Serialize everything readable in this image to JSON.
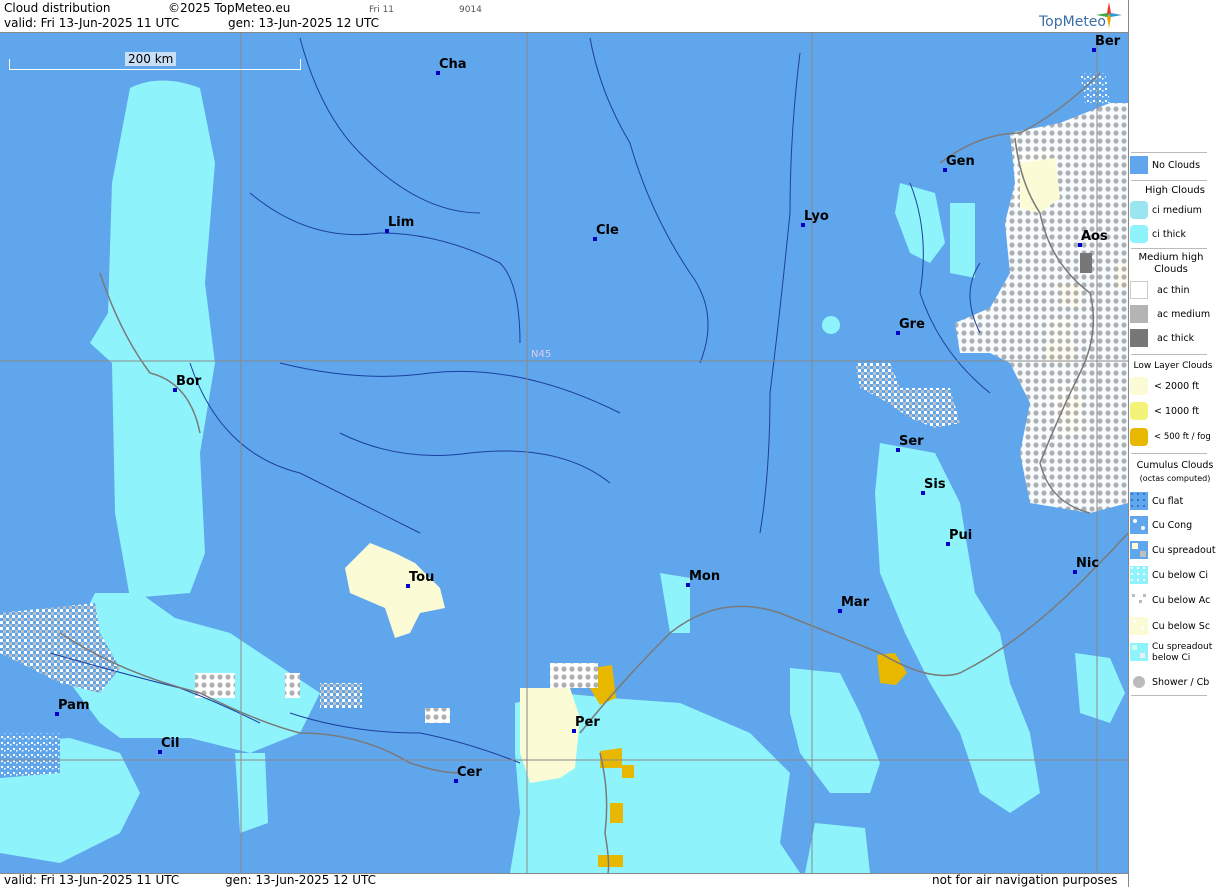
{
  "header": {
    "title": "Cloud distribution",
    "copyright": "©2025 TopMeteo.eu",
    "valid": "valid:  Fri  13-Jun-2025  11 UTC",
    "gen": "gen: 13-Jun-2025 12 UTC",
    "small1": "Fri 11",
    "small2": "9014",
    "logo": "TopMeteo"
  },
  "footer": {
    "valid": "valid:  Fri  13-Jun-2025  11 UTC",
    "gen": "gen: 13-Jun-2025 12 UTC",
    "notice": "not for air navigation purposes"
  },
  "map": {
    "scale": "200 km",
    "grid_label": "N45",
    "cities": [
      {
        "name": "Cha"
      },
      {
        "name": "Ber"
      },
      {
        "name": "Lim"
      },
      {
        "name": "Cle"
      },
      {
        "name": "Lyo"
      },
      {
        "name": "Gen"
      },
      {
        "name": "Aos"
      },
      {
        "name": "Gre"
      },
      {
        "name": "Bor"
      },
      {
        "name": "Ser"
      },
      {
        "name": "Sis"
      },
      {
        "name": "Pui"
      },
      {
        "name": "Tou"
      },
      {
        "name": "Mon"
      },
      {
        "name": "Mar"
      },
      {
        "name": "Nic"
      },
      {
        "name": "Pam"
      },
      {
        "name": "Cil"
      },
      {
        "name": "Per"
      },
      {
        "name": "Cer"
      }
    ]
  },
  "legend": {
    "no_clouds": "No Clouds",
    "high_clouds": "High Clouds",
    "ci_medium": "ci medium",
    "ci_thick": "ci thick",
    "medium_high": "Medium high Clouds",
    "ac_thin": "ac thin",
    "ac_medium": "ac medium",
    "ac_thick": "ac thick",
    "low_layer": "Low Layer Clouds",
    "lt2000": "< 2000 ft",
    "lt1000": "< 1000 ft",
    "lt500": "< 500 ft / fog",
    "cumulus": "Cumulus Clouds",
    "octas": "(octas computed)",
    "cu_flat": "Cu flat",
    "cu_cong": "Cu Cong",
    "cu_spreadout": "Cu spreadout",
    "cu_below_ci": "Cu below Ci",
    "cu_below_ac": "Cu below Ac",
    "cu_below_sc": "Cu below Sc",
    "cu_spreadout_below_ci": "Cu spreadout below Ci",
    "shower": "Shower / Cb"
  },
  "colors": {
    "no_clouds": "#5fa6ec",
    "ci_medium": "#99e6f0",
    "ci_thick": "#8ef3fb",
    "ac_medium": "#b4b4b4",
    "ac_thick": "#777777",
    "lt2000": "#fbfbd6",
    "lt1000": "#f3f37a",
    "lt500": "#e8b800"
  }
}
